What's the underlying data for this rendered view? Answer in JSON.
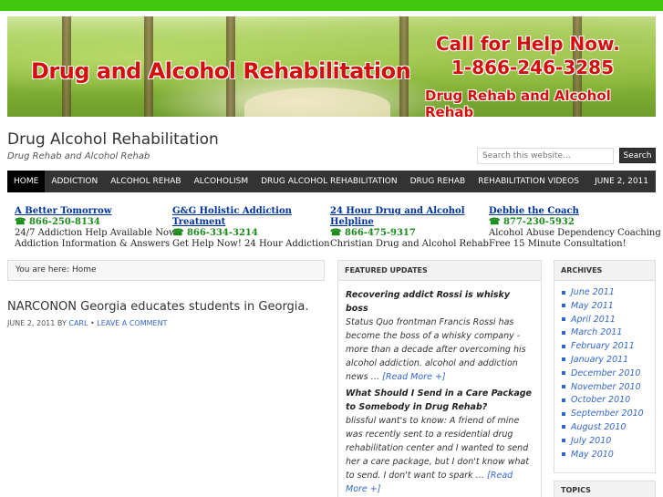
{
  "banner": {
    "title": "Drug and Alcohol Rehabilitation",
    "call": "Call for Help Now.",
    "phone": "1-866-246-3285",
    "sub": "Drug Rehab and Alcohol Rehab"
  },
  "site": {
    "title": "Drug Alcohol Rehabilitation",
    "description": "Drug Rehab and Alcohol Rehab"
  },
  "search": {
    "placeholder": "Search this website…",
    "button": "Search"
  },
  "nav": {
    "items": [
      "HOME",
      "ADDICTION",
      "ALCOHOL REHAB",
      "ALCOHOLISM",
      "DRUG ALCOHOL REHABILITATION",
      "DRUG REHAB",
      "REHABILITATION VIDEOS"
    ],
    "date": "JUNE 2, 2011"
  },
  "ads": [
    {
      "title": "A Better Tomorrow",
      "phone": "☎ 866-250-8134",
      "line1": "24/7 Addiction Help Available Now",
      "line2": "Addiction Information & Answers"
    },
    {
      "title": "G&G Holistic Addiction Treatment",
      "phone": "☎ 866-334-3214",
      "line1": "Get Help Now! 24 Hour Addiction",
      "line2": ""
    },
    {
      "title": "24 Hour Drug and Alcohol Helpline",
      "phone": "☎ 866-475-9317",
      "line1": "Christian Drug and Alcohol Rehab",
      "line2": ""
    },
    {
      "title": "Debbie the Coach",
      "phone": "☎ 877-230-5932",
      "line1": "Alcohol Abuse Dependency Coaching",
      "line2": "Free 15 Minute Consultation!"
    }
  ],
  "breadcrumb": "You are here: Home",
  "post": {
    "title": "NARCONON Georgia educates students in Georgia.",
    "date": "JUNE 2, 2011",
    "by": "BY",
    "author": "CARL",
    "sep": "•",
    "comment": "LEAVE A COMMENT"
  },
  "featured": {
    "heading": "FEATURED UPDATES",
    "items": [
      {
        "title": "Recovering addict Rossi is whisky boss",
        "text": "Status Quo frontman Francis Rossi has become the boss of a whisky company - more than a decade after overcoming his alcohol addiction. alcohol and addiction news …",
        "more": "[Read More +]"
      },
      {
        "title": "What Should I Send in a Care Package to Somebody in Drug Rehab?",
        "text": "blissful want's to know: A friend of mine was recently sent to a residential drug rehabilitation center and I wanted to send her a care package, but I don't know what to send. I don't want to spark …",
        "more": "[Read More +]"
      }
    ]
  },
  "archives": {
    "heading": "ARCHIVES",
    "items": [
      "June 2011",
      "May 2011",
      "April 2011",
      "March 2011",
      "February 2011",
      "January 2011",
      "December 2010",
      "November 2010",
      "October 2010",
      "September 2010",
      "August 2010",
      "July 2010",
      "May 2010"
    ]
  },
  "topics": {
    "heading": "TOPICS"
  }
}
